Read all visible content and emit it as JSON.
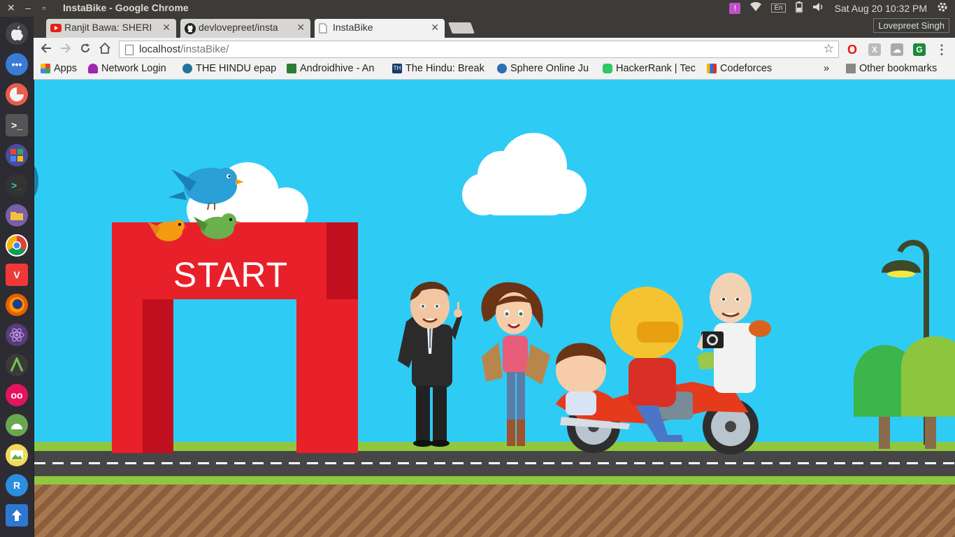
{
  "window": {
    "title": "InstaBike - Google Chrome"
  },
  "system_tray": {
    "notification": "!",
    "keyboard_layout": "En",
    "datetime": "Sat Aug 20 10:32 PM"
  },
  "chrome": {
    "profile_name": "Lovepreet Singh",
    "tabs": [
      {
        "label": "Ranjit Bawa: SHERI",
        "icon": "youtube-icon",
        "active": false
      },
      {
        "label": "devlovepreet/insta",
        "icon": "github-icon",
        "active": false
      },
      {
        "label": "InstaBike",
        "icon": "page-icon",
        "active": true
      }
    ],
    "url": {
      "host": "localhost",
      "path": "/instaBike/"
    },
    "bookmarks": [
      {
        "label": "Apps",
        "icon": "apps-grid-icon",
        "color": "#e94335"
      },
      {
        "label": "Network Login",
        "icon": "umbrella-icon",
        "color": "#9c27b0"
      },
      {
        "label": "THE HINDU epap",
        "icon": "wordpress-icon",
        "color": "#21759b"
      },
      {
        "label": "Androidhive - An",
        "icon": "androidhive-icon",
        "color": "#2e7d32"
      },
      {
        "label": "The Hindu: Break",
        "icon": "the-hindu-icon",
        "color": "#1a3a6e"
      },
      {
        "label": "Sphere Online Ju",
        "icon": "spoj-icon",
        "color": "#2a6fb8"
      },
      {
        "label": "HackerRank | Tec",
        "icon": "hackerrank-icon",
        "color": "#2ec866"
      },
      {
        "label": "Codeforces",
        "icon": "codeforces-icon",
        "color": "#f4b400"
      }
    ],
    "bookmarks_overflow": "»",
    "other_bookmarks": "Other bookmarks"
  },
  "page": {
    "gate_label": "START",
    "sky_color": "#2ecbf5"
  }
}
